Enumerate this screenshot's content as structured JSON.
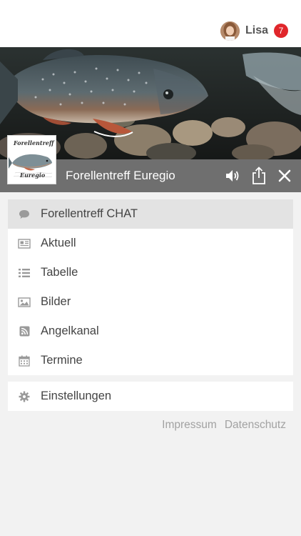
{
  "user": {
    "name": "Lisa",
    "badge": "7"
  },
  "header": {
    "title": "Forellentreff Euregio"
  },
  "logo": {
    "line1": "Forellentreff",
    "line2": "Euregio"
  },
  "menu": [
    {
      "label": "Forellentreff CHAT",
      "icon": "chat-bubble-icon"
    },
    {
      "label": "Aktuell",
      "icon": "newspaper-icon"
    },
    {
      "label": "Tabelle",
      "icon": "list-icon"
    },
    {
      "label": "Bilder",
      "icon": "image-icon"
    },
    {
      "label": "Angelkanal",
      "icon": "rss-icon"
    },
    {
      "label": "Termine",
      "icon": "calendar-icon"
    }
  ],
  "settings": {
    "label": "Einstellungen",
    "icon": "gear-icon"
  },
  "footer": {
    "impressum": "Impressum",
    "datenschutz": "Datenschutz"
  },
  "colors": {
    "titlebar": "#6f6f6f",
    "badge": "#e0262b",
    "active": "#e3e3e3",
    "background": "#f2f2f2"
  }
}
